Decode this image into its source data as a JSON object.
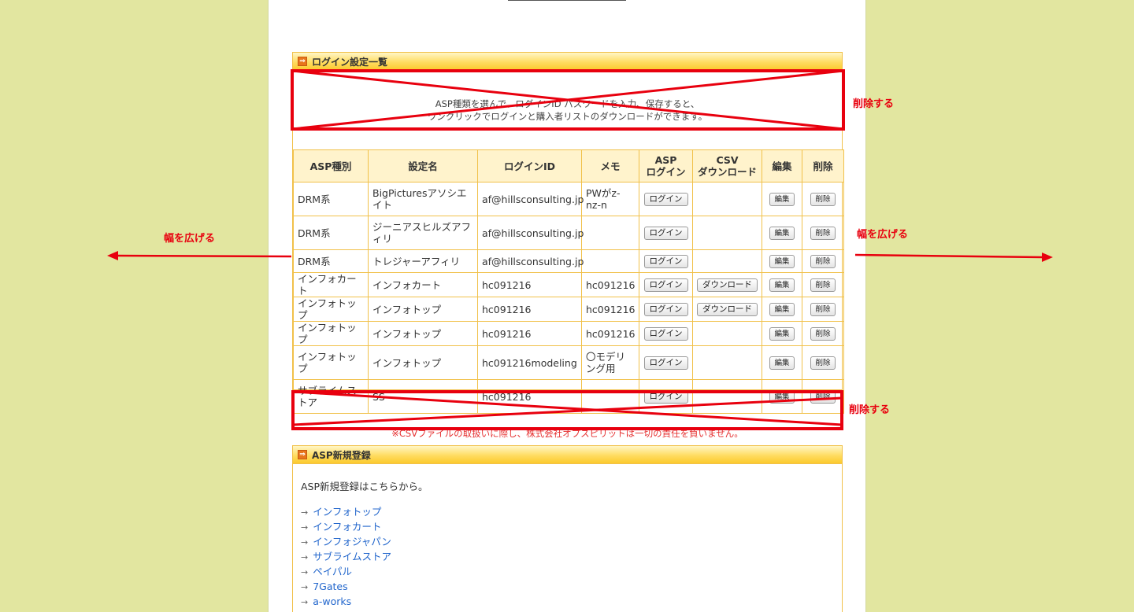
{
  "login_panel": {
    "title": "ログイン設定一覧",
    "info_lines": [
      "ASP種類を選んで、ログインID パスワードを入力、保存すると、",
      "ワンクリックでログインと購入者リストのダウンロードができます。"
    ],
    "columns": [
      "ASP種別",
      "設定名",
      "ログインID",
      "メモ",
      "ASP\nログイン",
      "CSV\nダウンロード",
      "編集",
      "削除"
    ],
    "rows": [
      {
        "type": "DRM系",
        "name": "BigPicturesアソシエイト",
        "login_id": "af@hillsconsulting.jp",
        "memo": "PWがz-nz-n",
        "csv": ""
      },
      {
        "type": "DRM系",
        "name": "ジーニアスヒルズアフィリ",
        "login_id": "af@hillsconsulting.jp",
        "memo": "",
        "csv": ""
      },
      {
        "type": "DRM系",
        "name": "トレジャーアフィリ",
        "login_id": "af@hillsconsulting.jp",
        "memo": "",
        "csv": ""
      },
      {
        "type": "インフォカート",
        "name": "インフォカート",
        "login_id": "hc091216",
        "memo": "hc091216",
        "csv": "ダウンロード"
      },
      {
        "type": "インフォトップ",
        "name": "インフォトップ",
        "login_id": "hc091216",
        "memo": "hc091216",
        "csv": "ダウンロード"
      },
      {
        "type": "インフォトップ",
        "name": "インフォトップ",
        "login_id": "hc091216",
        "memo": "hc091216",
        "csv": ""
      },
      {
        "type": "インフォトップ",
        "name": "インフォトップ",
        "login_id": "hc091216modeling",
        "memo": "〇モデリング用",
        "csv": ""
      },
      {
        "type": "サブライムストア",
        "name": "SS",
        "login_id": "hc091216",
        "memo": "",
        "csv": ""
      }
    ],
    "login_button": "ログイン",
    "edit_button": "編集",
    "delete_button": "削除",
    "csv_note": "※CSVファイルの取扱いに際し、株式会社オプスピリットは一切の責任を負いません。"
  },
  "asp_panel": {
    "title": "ASP新規登録",
    "intro": "ASP新規登録はこちらから。",
    "links": [
      "インフォトップ",
      "インフォカート",
      "インフォジャパン",
      "サブライムストア",
      "ペイパル",
      "7Gates",
      "a-works"
    ]
  },
  "annotations": {
    "delete_label": "削除する",
    "widen_label": "幅を広げる"
  },
  "colors": {
    "background": "#e2e6a0",
    "panel_border": "#f1c14a",
    "header_fill": "#ffdc61",
    "annotation": "#e8000e",
    "link": "#2266cc"
  }
}
